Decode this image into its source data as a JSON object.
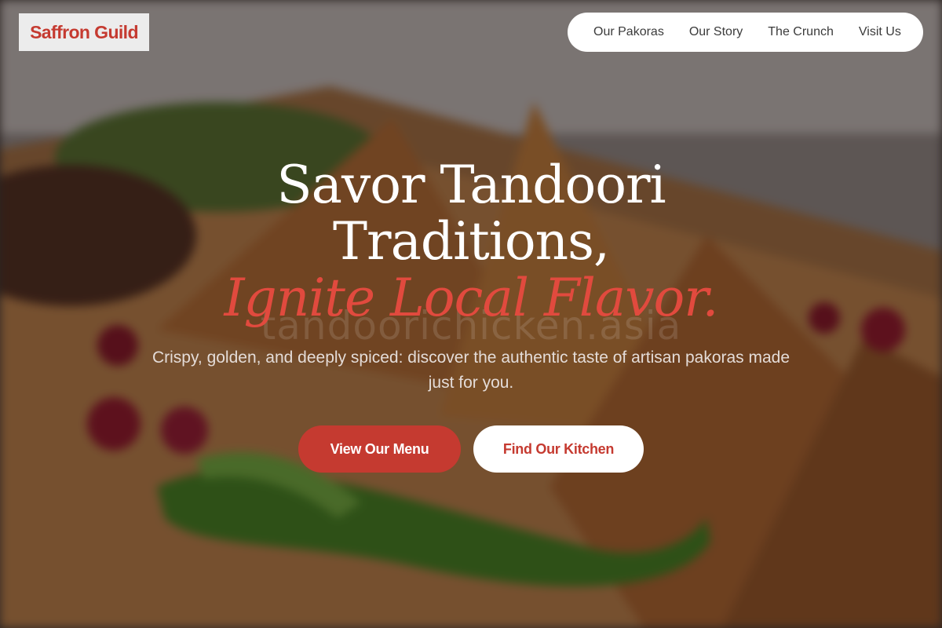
{
  "brand": {
    "name": "Saffron Guild",
    "color": "#c53a30"
  },
  "nav": {
    "items": [
      {
        "label": "Our Pakoras"
      },
      {
        "label": "Our Story"
      },
      {
        "label": "The Crunch"
      },
      {
        "label": "Visit Us"
      }
    ]
  },
  "hero": {
    "headline_line1": "Savor Tandoori",
    "headline_line2": "Traditions,",
    "headline_accent": "Ignite Local Flavor.",
    "watermark": "tandoorichicken.asia",
    "subtext": "Crispy, golden, and deeply spiced: discover the authentic taste of artisan pakoras made just for you.",
    "primary_button": "View Our Menu",
    "secondary_button": "Find Our Kitchen",
    "accent_color": "#e14a3e"
  }
}
